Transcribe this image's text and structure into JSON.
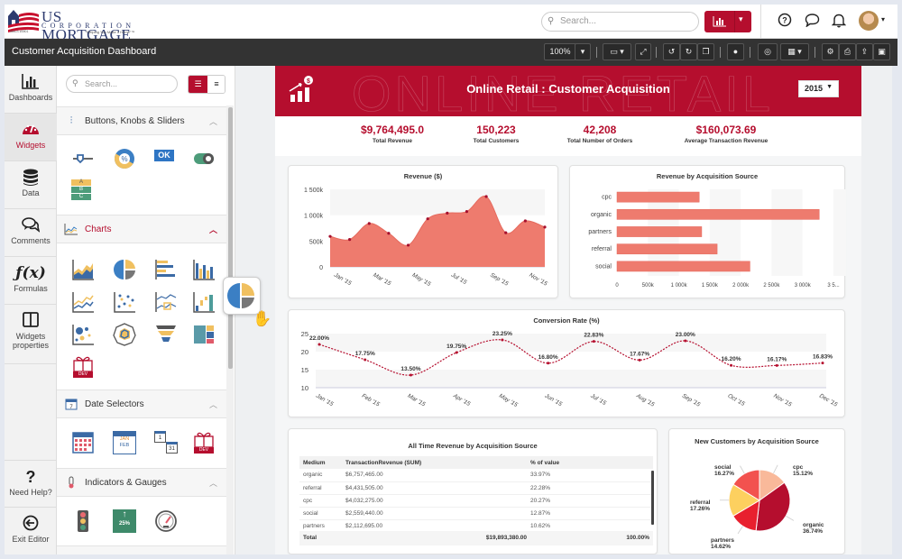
{
  "topbar": {
    "logo_name": "US MORTGAGE",
    "logo_sub": "CORPORATION",
    "logo_tagline": "\"Helping You Make It Home\"™",
    "logo_nmls": "NMLS #3901",
    "search_placeholder": "Search...",
    "icons": [
      "help-icon",
      "chat-icon",
      "bell-icon",
      "avatar"
    ]
  },
  "toolbar": {
    "title": "Customer Acquisition Dashboard",
    "zoom": "100%"
  },
  "rail": {
    "items": [
      {
        "label": "Dashboards",
        "icon": "bar-chart-icon"
      },
      {
        "label": "Widgets",
        "icon": "gauge-icon",
        "active": true
      },
      {
        "label": "Data",
        "icon": "database-icon"
      },
      {
        "label": "Comments",
        "icon": "comments-icon"
      },
      {
        "label": "Formulas",
        "icon": "function-icon"
      },
      {
        "label": "Widgets properties",
        "icon": "columns-icon"
      },
      {
        "label": "Need Help?",
        "icon": "question-icon"
      },
      {
        "label": "Exit Editor",
        "icon": "exit-icon"
      }
    ]
  },
  "widget_panel": {
    "search_placeholder": "Search...",
    "sections": [
      {
        "label": "Buttons, Knobs & Sliders",
        "expanded": true
      },
      {
        "label": "Charts",
        "expanded": true,
        "active": true
      },
      {
        "label": "Date Selectors",
        "expanded": true
      },
      {
        "label": "Indicators & Gauges",
        "expanded": true
      }
    ],
    "ok_label": "OK",
    "dev_label": "DEV",
    "kpi_badge": "25%",
    "abc": [
      "A",
      "B",
      "C"
    ],
    "cal_months": [
      "JAN",
      "FEB"
    ],
    "cal_days": [
      "1",
      "31"
    ]
  },
  "dashboard": {
    "title": "Online Retail : Customer Acquisition",
    "bg_text": "ONLINE RETAIL",
    "year": "2015",
    "accent": "#b50e2e",
    "kpis": [
      {
        "value": "$9,764,495.0",
        "label": "Total Revenue"
      },
      {
        "value": "150,223",
        "label": "Total Customers"
      },
      {
        "value": "42,208",
        "label": "Total Number of Orders"
      },
      {
        "value": "$160,073.69",
        "label": "Average Transaction Revenue"
      }
    ],
    "table": {
      "title": "All Time Revenue by Acquisition Source",
      "headers": [
        "Medium",
        "TransactionRevenue (SUM)",
        "% of value"
      ],
      "rows": [
        [
          "organic",
          "$6,757,465.00",
          "33.97%"
        ],
        [
          "referral",
          "$4,431,505.00",
          "22.28%"
        ],
        [
          "cpc",
          "$4,032,275.00",
          "20.27%"
        ],
        [
          "social",
          "$2,559,440.00",
          "12.87%"
        ],
        [
          "partners",
          "$2,112,695.00",
          "10.62%"
        ]
      ],
      "total_label": "Total",
      "total_value": "$19,893,380.00",
      "total_pct": "100.00%"
    }
  },
  "chart_data": [
    {
      "type": "area",
      "title": "Revenue ($)",
      "x": [
        "Jan '15",
        "Feb '15",
        "Mar '15",
        "Apr '15",
        "May '15",
        "Jun '15",
        "Jul '15",
        "Aug '15",
        "Sep '15",
        "Oct '15",
        "Nov '15",
        "Dec '15"
      ],
      "x_tick_labels": [
        "Jan '15",
        "Mar '15",
        "May '15",
        "Jul '15",
        "Sep '15",
        "Nov '15"
      ],
      "values": [
        590000,
        530000,
        840000,
        650000,
        420000,
        930000,
        1040000,
        1070000,
        1360000,
        660000,
        890000,
        770000
      ],
      "ylim": [
        0,
        1500000
      ],
      "y_ticks": [
        "0",
        "500k",
        "1 000k",
        "1 500k"
      ],
      "color": "#ee7b6e",
      "marker_color": "#a50f2d"
    },
    {
      "type": "bar",
      "orientation": "horizontal",
      "title": "Revenue by Acquisition Source",
      "categories": [
        "cpc",
        "organic",
        "partners",
        "referral",
        "social"
      ],
      "values": [
        1330000,
        3270000,
        1370000,
        1620000,
        2150000
      ],
      "xlim": [
        0,
        3500000
      ],
      "x_ticks": [
        "0",
        "500k",
        "1 000k",
        "1 500k",
        "2 000k",
        "2 500k",
        "3 000k",
        "3 5..."
      ],
      "color": "#ee7b6e"
    },
    {
      "type": "line",
      "title": "Conversion Rate (%)",
      "x": [
        "Jan '15",
        "Feb '15",
        "Mar '15",
        "Apr '15",
        "May '15",
        "Jun '15",
        "Jul '15",
        "Aug '15",
        "Sep '15",
        "Oct '15",
        "Nov '15",
        "Dec '15"
      ],
      "values": [
        22.0,
        17.75,
        13.5,
        19.75,
        23.25,
        16.8,
        22.83,
        17.67,
        23.0,
        16.2,
        16.17,
        16.83
      ],
      "labels": [
        "22.00%",
        "17.75%",
        "13.50%",
        "19.75%",
        "23.25%",
        "16.80%",
        "22.83%",
        "17.67%",
        "23.00%",
        "16.20%",
        "16.17%",
        "16.83%"
      ],
      "ylim": [
        10,
        25
      ],
      "y_ticks": [
        "10",
        "15",
        "20",
        "25"
      ],
      "color": "#b50e2e",
      "style": "dashed-spline"
    },
    {
      "type": "pie",
      "title": "New Customers by Acquisition Source",
      "slices": [
        {
          "label": "cpc",
          "value": 15.12,
          "text": "15.12%",
          "color": "#f9b99a"
        },
        {
          "label": "organic",
          "value": 36.74,
          "text": "36.74%",
          "color": "#b50e2e"
        },
        {
          "label": "partners",
          "value": 14.62,
          "text": "14.62%",
          "color": "#e8202e"
        },
        {
          "label": "referral",
          "value": 17.26,
          "text": "17.26%",
          "color": "#fdd05f"
        },
        {
          "label": "social",
          "value": 16.27,
          "text": "16.27%",
          "color": "#f2524f"
        }
      ]
    }
  ]
}
